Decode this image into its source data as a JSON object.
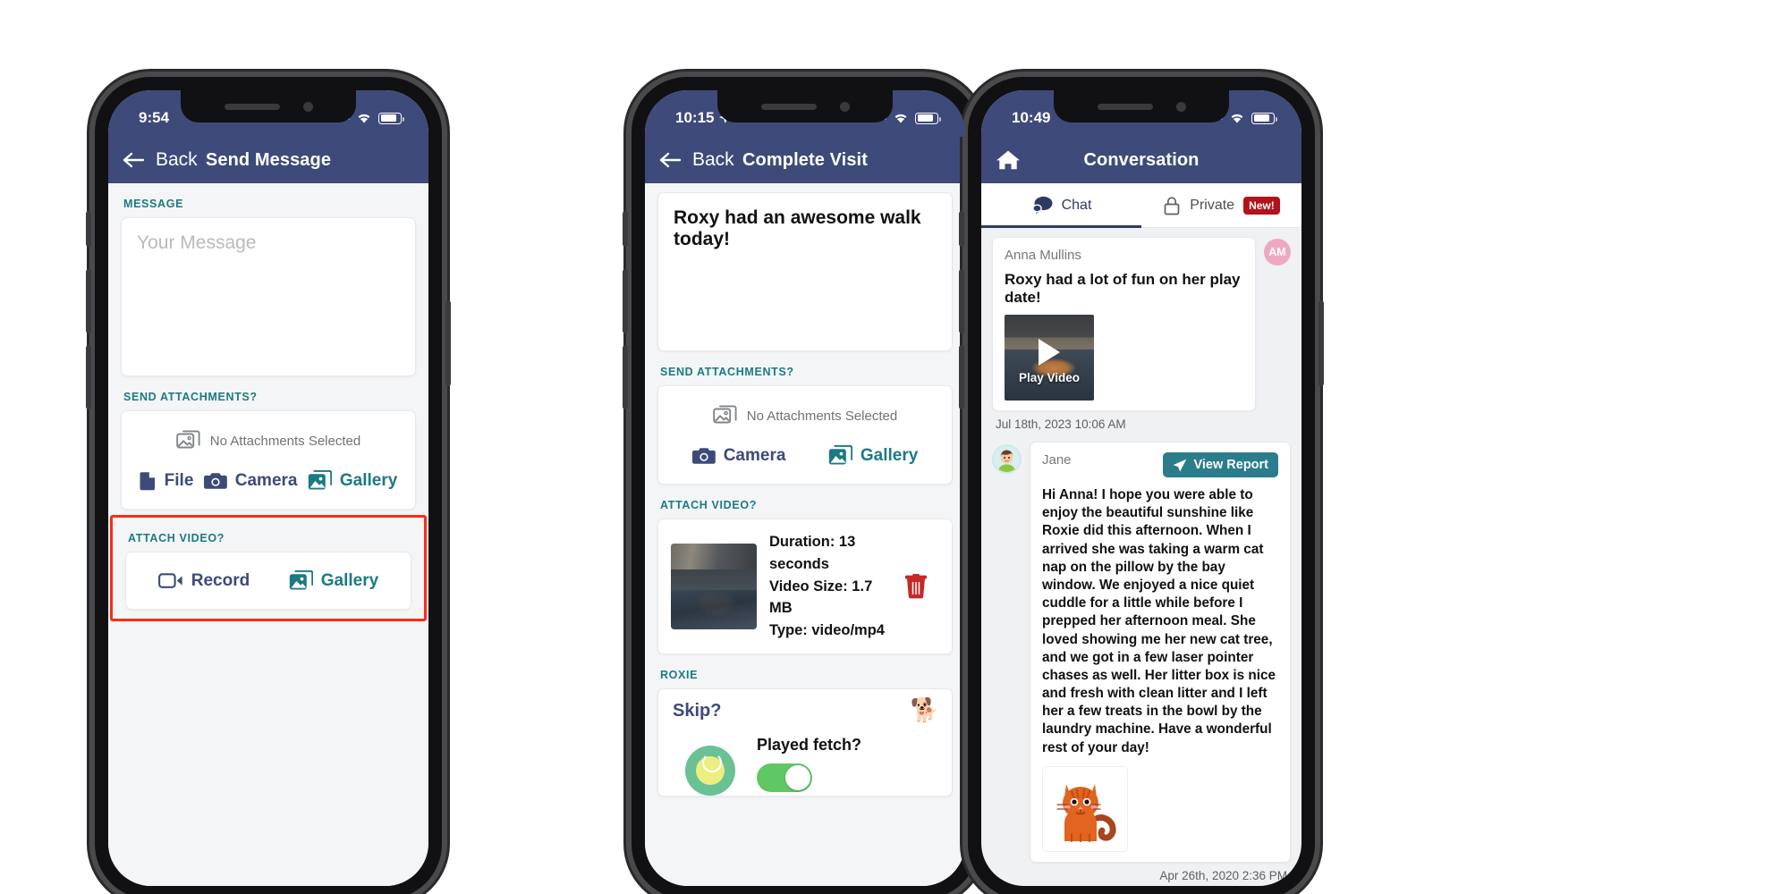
{
  "phones": {
    "one": {
      "status": {
        "time": "9:54"
      },
      "nav": {
        "back_label": "Back",
        "title": "Send Message",
        "back_icon": "arrow-left-icon"
      },
      "message_section": {
        "label": "MESSAGE",
        "placeholder": "Your Message",
        "value": ""
      },
      "attachments_section": {
        "label": "SEND ATTACHMENTS?",
        "status_text": "No Attachments Selected",
        "status_icon": "image-placeholder-icon",
        "actions": [
          {
            "label": "File",
            "icon": "file-icon",
            "color": "#3e4a79"
          },
          {
            "label": "Camera",
            "icon": "camera-icon",
            "color": "#3e4a79"
          },
          {
            "label": "Gallery",
            "icon": "gallery-icon",
            "color": "#1b7a84"
          }
        ]
      },
      "video_section": {
        "label": "ATTACH VIDEO?",
        "highlight_color": "#ff2a17",
        "actions": [
          {
            "label": "Record",
            "icon": "video-camera-icon",
            "color": "#3e4a79"
          },
          {
            "label": "Gallery",
            "icon": "gallery-icon",
            "color": "#1b7a84"
          }
        ]
      }
    },
    "two": {
      "status": {
        "time": "10:15",
        "location_icon": "location-arrow-icon"
      },
      "nav": {
        "back_label": "Back",
        "title": "Complete Visit",
        "back_icon": "arrow-left-icon"
      },
      "message_value": "Roxy had an awesome walk today!",
      "attachments_section": {
        "label": "SEND ATTACHMENTS?",
        "status_text": "No Attachments Selected",
        "status_icon": "image-placeholder-icon",
        "actions": [
          {
            "label": "Camera",
            "icon": "camera-icon",
            "color": "#3e4a79"
          },
          {
            "label": "Gallery",
            "icon": "gallery-icon",
            "color": "#1b7a84"
          }
        ]
      },
      "video_section": {
        "label": "ATTACH VIDEO?",
        "duration": "Duration: 13 seconds",
        "size": "Video Size: 1.7 MB",
        "type": "Type: video/mp4",
        "delete_icon": "trash-icon",
        "thumbnail_alt": "dog-lying-on-rug-thumbnail"
      },
      "pet_section": {
        "label": "ROXIE",
        "skip_label": "Skip?",
        "pet_icon": "dog-icon",
        "task_icon": "tennis-ball-icon",
        "task_label": "Played fetch?",
        "task_toggle_on": true
      }
    },
    "three": {
      "status": {
        "time": "10:49"
      },
      "nav": {
        "home_icon": "home-icon",
        "title": "Conversation"
      },
      "tabs": [
        {
          "label": "Chat",
          "icon": "chat-bubble-icon",
          "active": true,
          "badge": ""
        },
        {
          "label": "Private",
          "icon": "lock-icon",
          "active": false,
          "badge": "New!"
        }
      ],
      "messages": [
        {
          "author": "Anna Mullins",
          "avatar_initials": "AM",
          "avatar_color": "#efa8c4",
          "title": "Roxy had a lot of fun on her play date!",
          "video_label": "Play Video",
          "video_icon": "play-icon",
          "timestamp": "Jul 18th, 2023 10:06 AM",
          "timestamp_align": "left"
        },
        {
          "author": "Jane",
          "avatar_icon": "woman-avatar-icon",
          "action_label": "View Report",
          "action_icon": "send-icon",
          "body": "Hi Anna! I hope you were able to enjoy the beautiful sunshine like Roxie did this afternoon. When I arrived she was taking a warm cat nap on the pillow by the bay window. We enjoyed a nice quiet cuddle for a little while before I prepped her afternoon meal. She loved showing me her new cat tree, and we got in a few laser pointer chases as well. Her litter box is nice and fresh with clean litter and I left her a few treats in the bowl by the laundry machine. Have a wonderful rest of your day!",
          "image_icon": "orange-cat-illustration",
          "timestamp": "Apr 26th, 2020 2:36 PM",
          "timestamp_align": "right"
        }
      ]
    }
  },
  "colors": {
    "nav_blue": "#3e4a79",
    "teal": "#1b7a84",
    "accent_red": "#ff2a17",
    "badge_red": "#b4121b",
    "toggle_green": "#5fc764",
    "report_teal": "#2b7d8c"
  }
}
